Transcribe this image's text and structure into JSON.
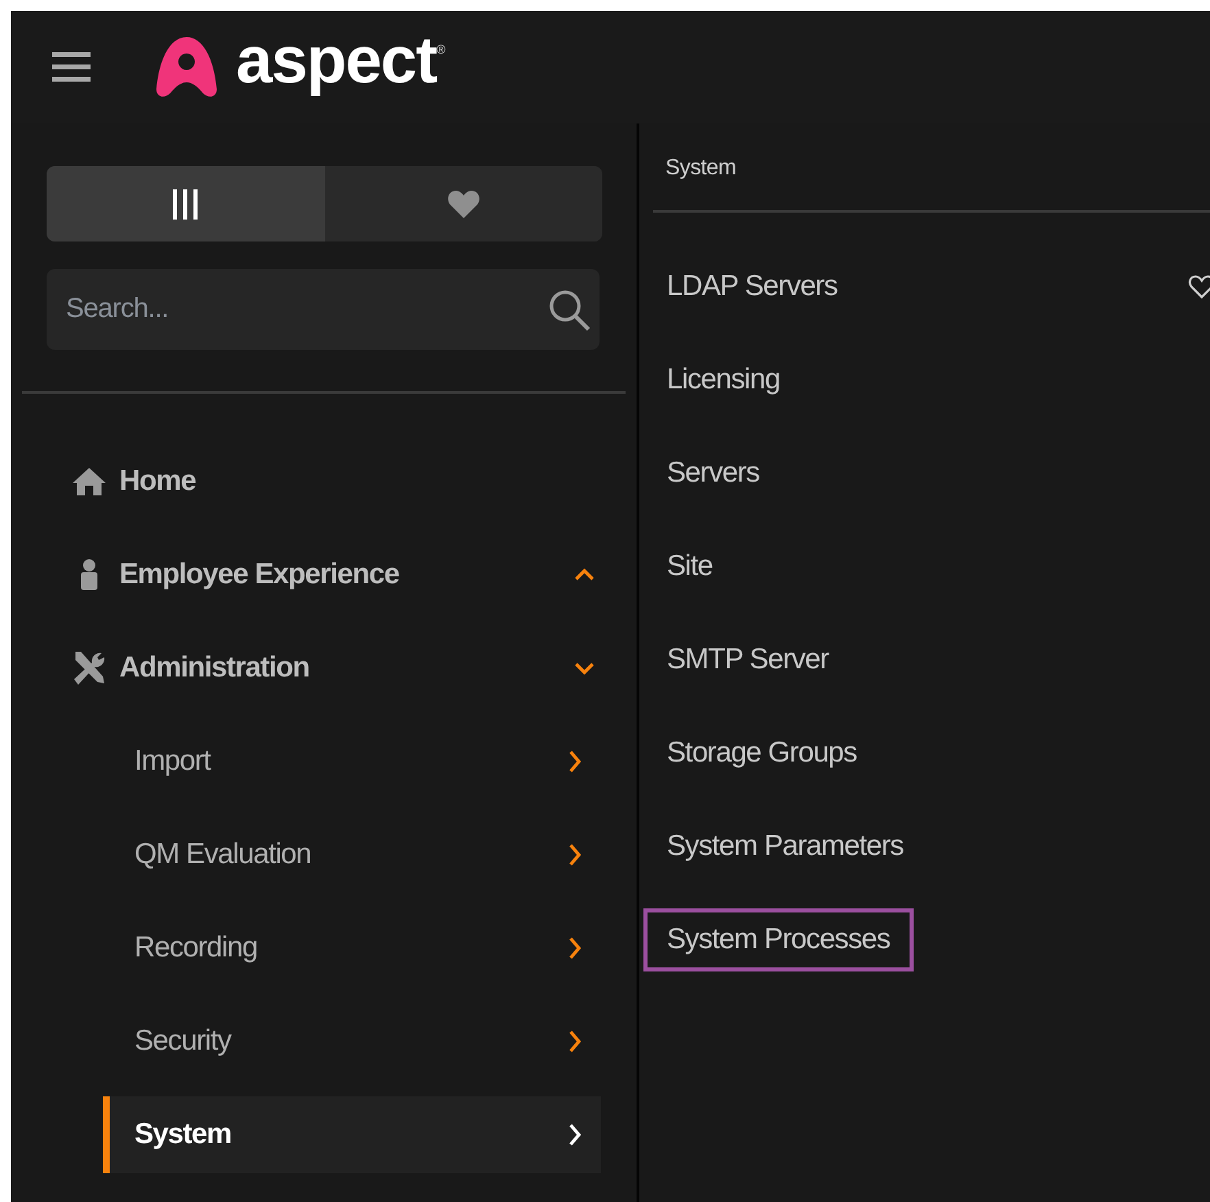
{
  "header": {
    "logo_text": "aspect",
    "registered_mark": "®"
  },
  "sidebar": {
    "view_tabs": [
      {
        "kind": "bars",
        "selected": true
      },
      {
        "kind": "heart",
        "selected": false
      }
    ],
    "search": {
      "placeholder": "Search..."
    },
    "items": [
      {
        "label": "Home",
        "kind": "home"
      },
      {
        "label": "Employee Experience",
        "kind": "person",
        "expanded": false
      },
      {
        "label": "Administration",
        "kind": "tools",
        "expanded": true,
        "children": [
          {
            "label": "Import",
            "selected": false
          },
          {
            "label": "QM Evaluation",
            "selected": false
          },
          {
            "label": "Recording",
            "selected": false
          },
          {
            "label": "Security",
            "selected": false
          },
          {
            "label": "System",
            "selected": true
          }
        ]
      }
    ]
  },
  "panel": {
    "title": "System",
    "items": [
      {
        "label": "LDAP Servers",
        "favorite_icon": true,
        "highlighted": false
      },
      {
        "label": "Licensing",
        "favorite_icon": false,
        "highlighted": false
      },
      {
        "label": "Servers",
        "favorite_icon": false,
        "highlighted": false
      },
      {
        "label": "Site",
        "favorite_icon": false,
        "highlighted": false
      },
      {
        "label": "SMTP Server",
        "favorite_icon": false,
        "highlighted": false
      },
      {
        "label": "Storage Groups",
        "favorite_icon": false,
        "highlighted": false
      },
      {
        "label": "System Parameters",
        "favorite_icon": false,
        "highlighted": false
      },
      {
        "label": "System Processes",
        "favorite_icon": false,
        "highlighted": true
      }
    ]
  }
}
